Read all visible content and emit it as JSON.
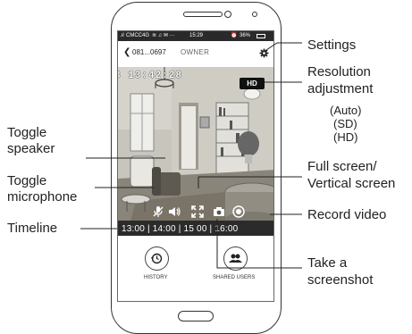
{
  "status_bar": {
    "carrier": "CMCC4G",
    "time": "15:29",
    "battery": "36%"
  },
  "app_bar": {
    "device_id": "081...0697",
    "role": "OWNER"
  },
  "video": {
    "timestamp": "3 13:42:28",
    "resolution_badge": "HD"
  },
  "timeline": {
    "labels": "13:00 | 14:00 | 15 00 | 16:00"
  },
  "buttons": {
    "history": "HISTORY",
    "shared_users": "SHARED USERS"
  },
  "annotations": {
    "settings": "Settings",
    "resolution_line1": "Resolution",
    "resolution_line2": "adjustment",
    "res_auto": "(Auto)",
    "res_sd": "(SD)",
    "res_hd": "(HD)",
    "toggle_speaker_1": "Toggle",
    "toggle_speaker_2": "speaker",
    "toggle_mic_1": "Toggle",
    "toggle_mic_2": "microphone",
    "timeline": "Timeline",
    "fullscreen_1": "Full screen/",
    "fullscreen_2": "Vertical screen",
    "record_video": "Record video",
    "screenshot_1": "Take a",
    "screenshot_2": "screenshot"
  },
  "icons": {
    "gear": "gear-icon",
    "back": "back-arrow-icon",
    "mic_off": "microphone-off-icon",
    "speaker": "speaker-icon",
    "fullscreen": "fullscreen-icon",
    "camera": "camera-icon",
    "record": "record-icon",
    "history": "history-icon",
    "users": "users-icon"
  }
}
